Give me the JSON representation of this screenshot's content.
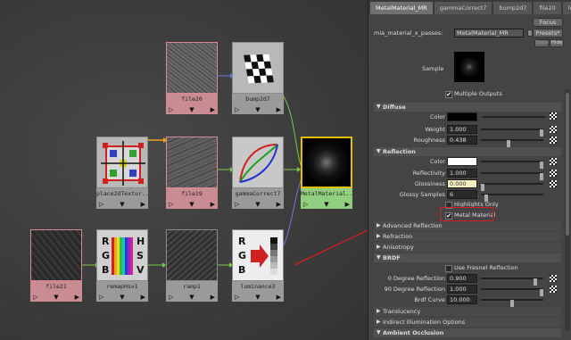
{
  "graph": {
    "nodes": [
      {
        "id": "file20",
        "label": "file20",
        "style": "pink"
      },
      {
        "id": "bump2d7",
        "label": "bump2d7",
        "style": "gray"
      },
      {
        "id": "place2dTexture",
        "label": "place2dTextur...",
        "style": "gray"
      },
      {
        "id": "file19",
        "label": "file19",
        "style": "pink"
      },
      {
        "id": "gammaCorrect7",
        "label": "gammaCorrect7",
        "style": "gray"
      },
      {
        "id": "MetalMaterial",
        "label": "MetalMaterial...",
        "style": "green"
      },
      {
        "id": "file21",
        "label": "file21",
        "style": "pink"
      },
      {
        "id": "remapHsv1",
        "label": "remapHsv1",
        "style": "gray"
      },
      {
        "id": "ramp1",
        "label": "ramp1",
        "style": "gray"
      },
      {
        "id": "luminance3",
        "label": "luminance3",
        "style": "gray"
      }
    ],
    "node_bar_glyphs": {
      "left": "▷",
      "mid": "▼",
      "right": "▶"
    },
    "remap_letters": {
      "left": [
        "R",
        "G",
        "B"
      ],
      "right": [
        "H",
        "S",
        "V"
      ]
    },
    "lum_letters": [
      "R",
      "G",
      "B"
    ],
    "colors": {
      "wire_green": "#7cc850",
      "wire_blue": "#6a7ae0",
      "wire_orange": "#f0a020",
      "annotation": "#d02020"
    }
  },
  "panel": {
    "tabs": [
      "MetalMaterial_MR",
      "gammaCorrect7",
      "bump2d7",
      "file20",
      "lu"
    ],
    "active_tab": 0,
    "buttons": {
      "focus": "Focus",
      "presets": "Presets*",
      "show": "Show",
      "hide": "Hide"
    },
    "node_type_label": "mia_material_x_passes:",
    "node_name": "MetalMaterial_MR",
    "sample_label": "Sample",
    "multiple_outputs": "Multiple Outputs",
    "sections": {
      "diffuse": "Diffuse",
      "reflection": "Reflection",
      "advanced_reflection": "Advanced Reflection",
      "refraction": "Refraction",
      "anisotropy": "Anisotropy",
      "brdf": "BRDF",
      "translucency": "Translucency",
      "indirect_illumination": "Indirect Illumination Options",
      "ambient_occlusion": "Ambient Occlusion"
    },
    "diffuse": {
      "color_label": "Color",
      "color": "#000000",
      "weight_label": "Weight",
      "weight": "1.000",
      "weight_frac": 1.0,
      "roughness_label": "Roughness",
      "roughness": "0.438",
      "roughness_frac": 0.438
    },
    "reflection": {
      "color_label": "Color",
      "color": "#ffffff",
      "reflectivity_label": "Reflectivity",
      "reflectivity": "1.000",
      "reflectivity_frac": 1.0,
      "glossiness_label": "Glossiness",
      "glossiness": "0.000",
      "glossiness_frac": 0.0,
      "glossy_samples_label": "Glossy Samples",
      "glossy_samples": "6",
      "glossy_samples_frac": 0.06,
      "highlights_only": "Highlights Only",
      "highlights_only_checked": false,
      "metal_material": "Metal Material",
      "metal_material_checked": true
    },
    "brdf": {
      "use_fresnel": "Use Fresnel Reflection",
      "use_fresnel_checked": false,
      "deg0_label": "0 Degree Reflection",
      "deg0": "0.900",
      "deg0_frac": 0.9,
      "deg90_label": "90 Degree Reflection",
      "deg90": "1.000",
      "deg90_frac": 1.0,
      "curve_label": "Brdf Curve",
      "curve": "10.000",
      "curve_frac": 0.5
    },
    "colors": {
      "glossiness_field": "#f5f0c0",
      "highlight": "#d02020"
    }
  }
}
